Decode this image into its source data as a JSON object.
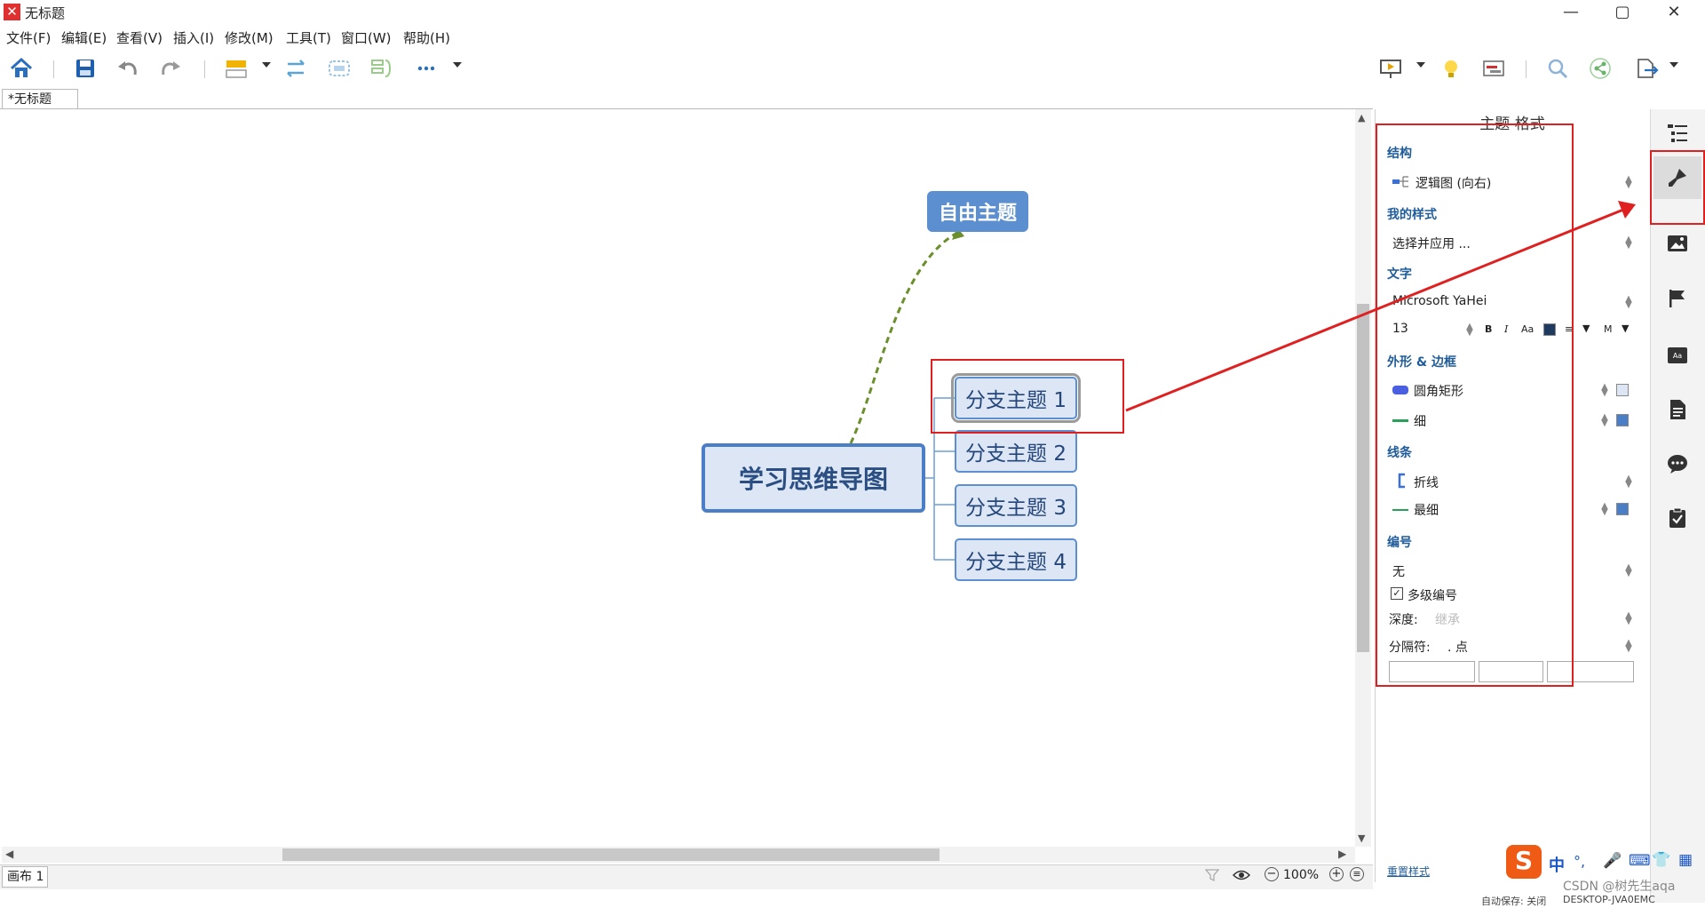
{
  "window": {
    "title": "无标题",
    "logo_text": "✕",
    "controls": [
      "—",
      "▢",
      "✕"
    ]
  },
  "menu": {
    "items": [
      "文件(F)",
      "编辑(E)",
      "查看(V)",
      "插入(I)",
      "修改(M)",
      "工具(T)",
      "窗口(W)",
      "帮助(H)"
    ]
  },
  "toolbar": {
    "icons": [
      "home-icon",
      "save-icon",
      "undo-icon",
      "redo-icon",
      "topic-icon",
      "relationship-icon",
      "boundary-icon",
      "summary-icon",
      "more-icon",
      "presentation-icon",
      "idea-icon",
      "gantt-icon",
      "search-icon",
      "share-icon",
      "export-icon"
    ]
  },
  "tab": {
    "label": "*无标题"
  },
  "mindmap": {
    "central": "学习思维导图",
    "branches": [
      "分支主题 1",
      "分支主题 2",
      "分支主题 3",
      "分支主题 4"
    ],
    "free_topic": "自由主题"
  },
  "panel": {
    "title": "主题 格式",
    "structure": {
      "heading": "结构",
      "value": "逻辑图 (向右)"
    },
    "my_style": {
      "heading": "我的样式",
      "value": "选择并应用 ..."
    },
    "text": {
      "heading": "文字",
      "font": "Microsoft YaHei",
      "size": "13",
      "bold": "B",
      "italic": "I",
      "case": "Aa",
      "align": "≡",
      "more": "M"
    },
    "shape_border": {
      "heading": "外形 & 边框",
      "shape": "圆角矩形",
      "border": "细"
    },
    "line": {
      "heading": "线条",
      "type": "折线",
      "weight": "最细"
    },
    "numbering": {
      "heading": "编号",
      "value": "无",
      "multi_level_label": "多级编号",
      "depth_label": "深度:",
      "depth_value": "继承",
      "separator_label": "分隔符:",
      "separator_value": ". 点"
    },
    "reset_link": "重置样式"
  },
  "status": {
    "canvas_tab": "画布 1",
    "zoom": "100%"
  },
  "watermark": {
    "csdn": "CSDN @树先生aqa",
    "autosave": "自动保存: 关闭",
    "computer": "DESKTOP-JVA0EMC"
  },
  "ime": {
    "items": [
      "中",
      "°,",
      "🎤",
      "⌨",
      "👕",
      "▦"
    ]
  },
  "colors": {
    "accent": "#4a7ec6",
    "topic_fill": "#dce6f5",
    "free_topic": "#5b8fd0",
    "section_heading": "#1f5c99",
    "annotation_red": "#e02020",
    "relationship_line": "#6b8f2a",
    "text_color_swatch": "#1f3a5f"
  }
}
